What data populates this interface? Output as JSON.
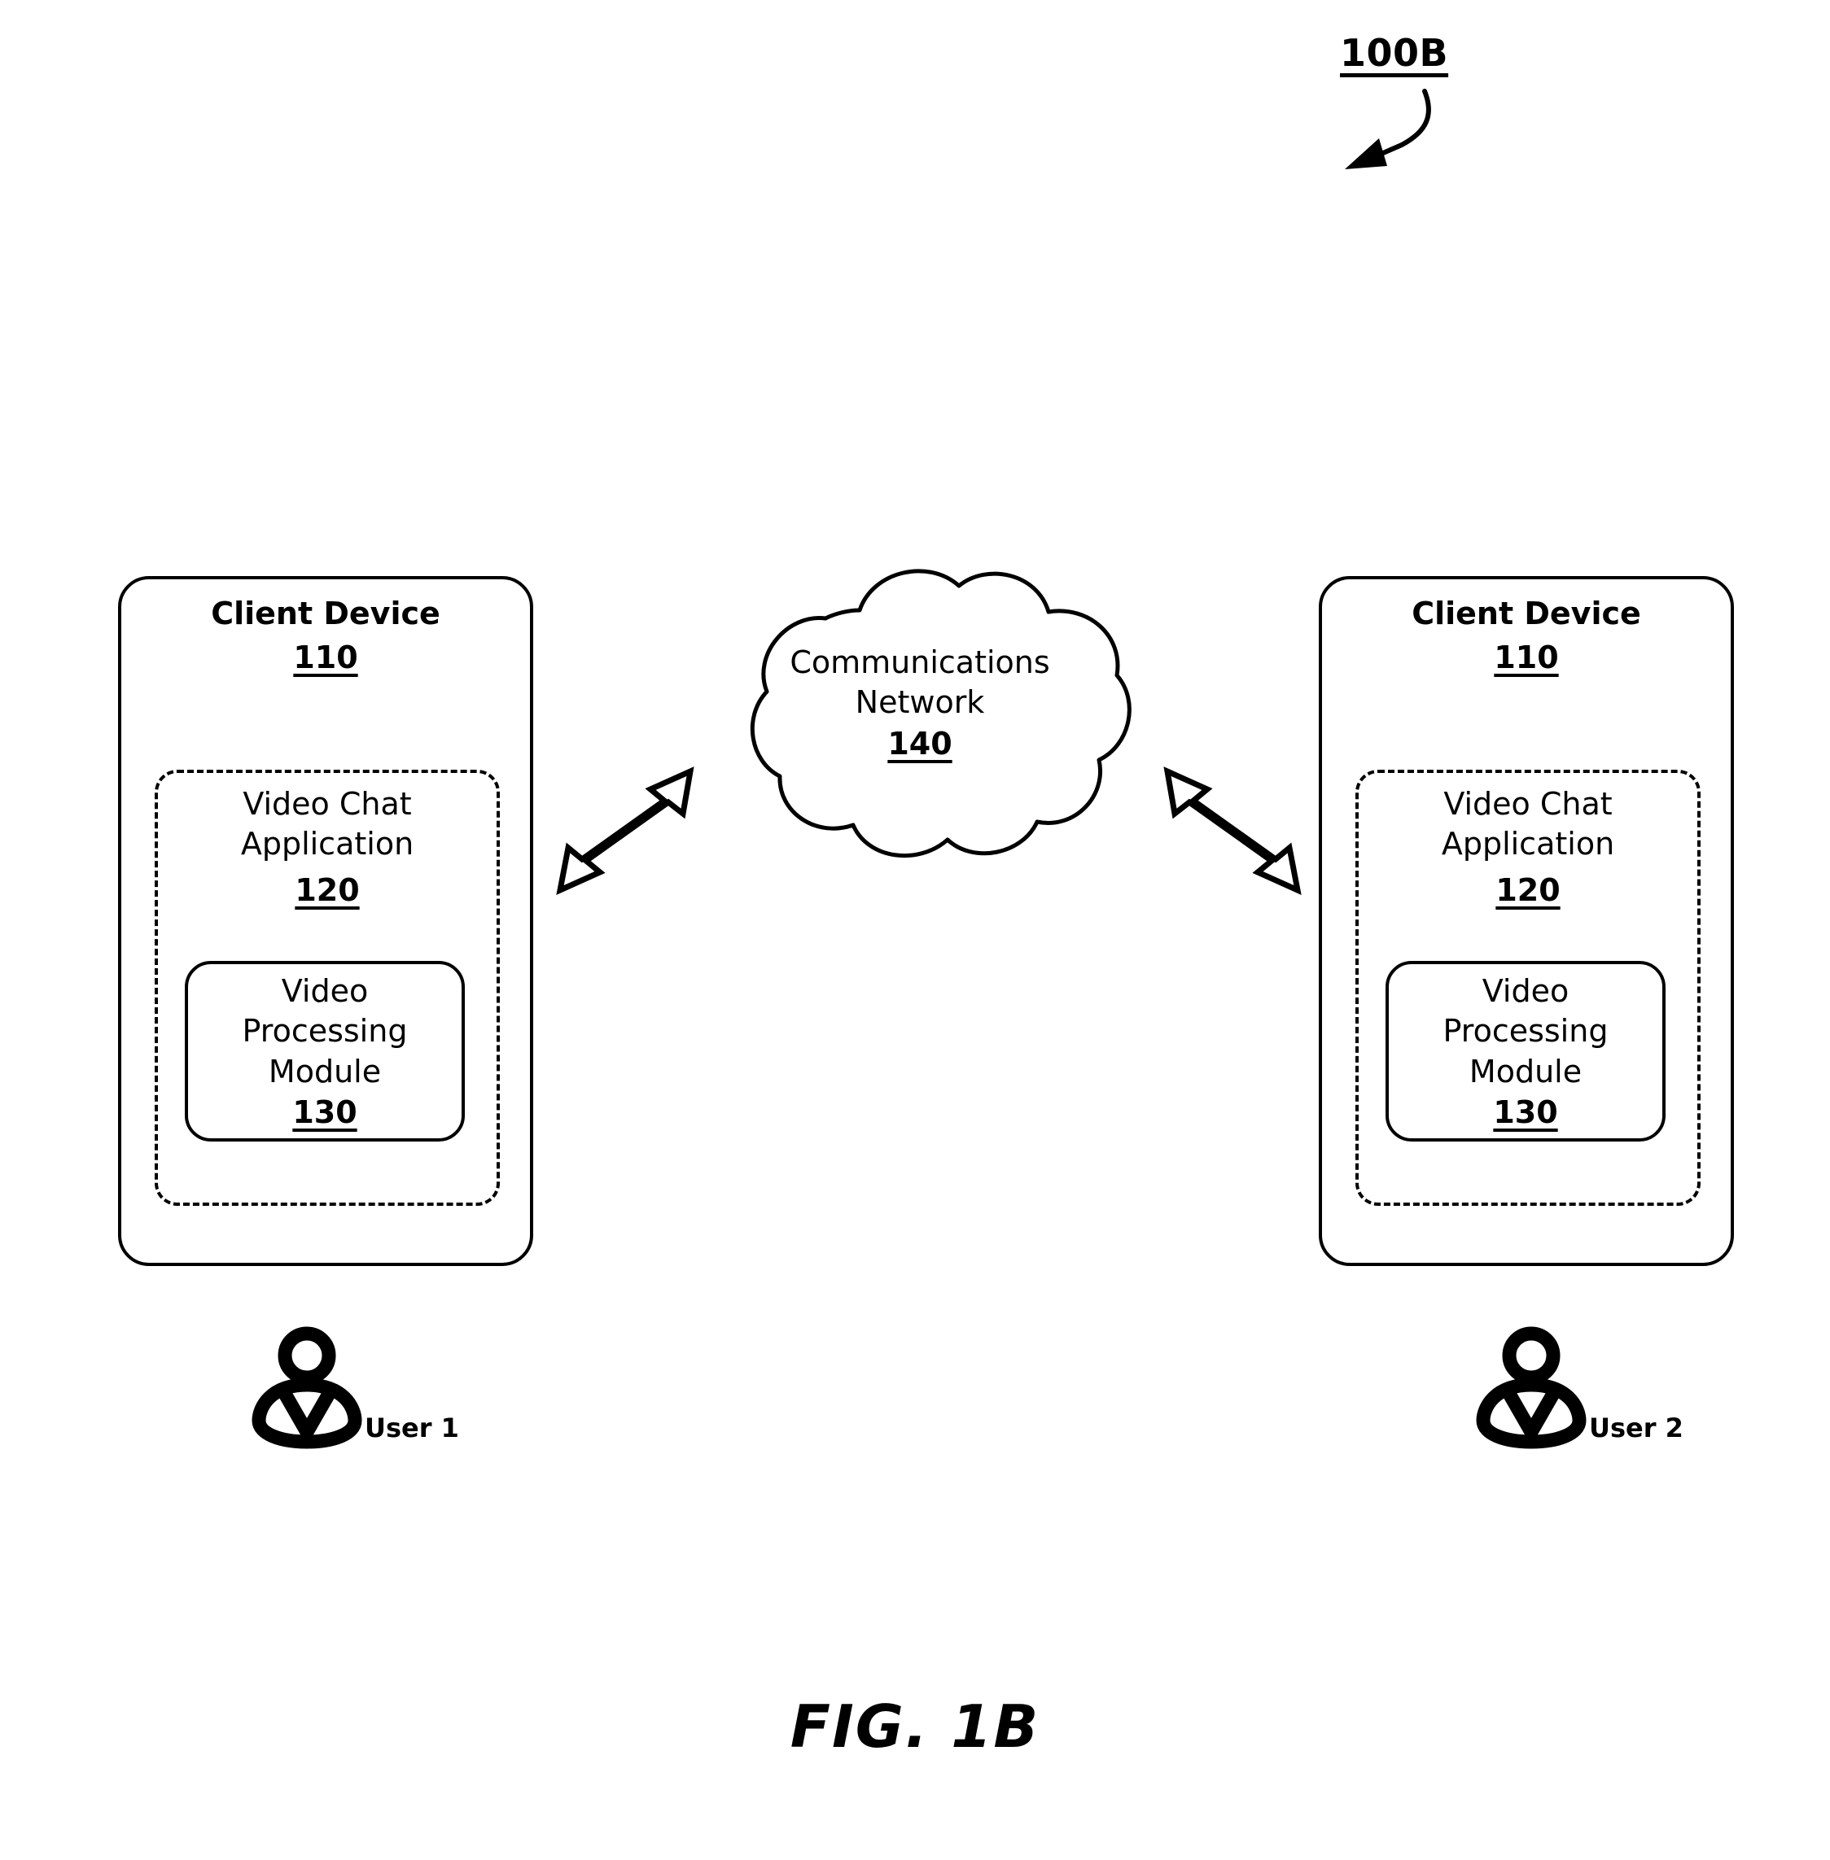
{
  "figure": {
    "callout_label": "100B",
    "caption": "FIG. 1B"
  },
  "devices": [
    {
      "id": "left",
      "title": "Client Device",
      "ref": "110",
      "application": {
        "name_line1": "Video Chat",
        "name_line2": "Application",
        "ref": "120"
      },
      "module": {
        "name_line1": "Video",
        "name_line2": "Processing",
        "name_line3": "Module",
        "ref": "130"
      },
      "user_label": "User 1"
    },
    {
      "id": "right",
      "title": "Client Device",
      "ref": "110",
      "application": {
        "name_line1": "Video Chat",
        "name_line2": "Application",
        "ref": "120"
      },
      "module": {
        "name_line1": "Video",
        "name_line2": "Processing",
        "name_line3": "Module",
        "ref": "130"
      },
      "user_label": "User 2"
    }
  ],
  "network": {
    "name_line1": "Communications",
    "name_line2": "Network",
    "ref": "140"
  },
  "connectors": {
    "left_arrow_name": "bidirectional-arrow",
    "right_arrow_name": "bidirectional-arrow"
  },
  "colors": {
    "stroke": "#000000",
    "background": "#ffffff"
  }
}
